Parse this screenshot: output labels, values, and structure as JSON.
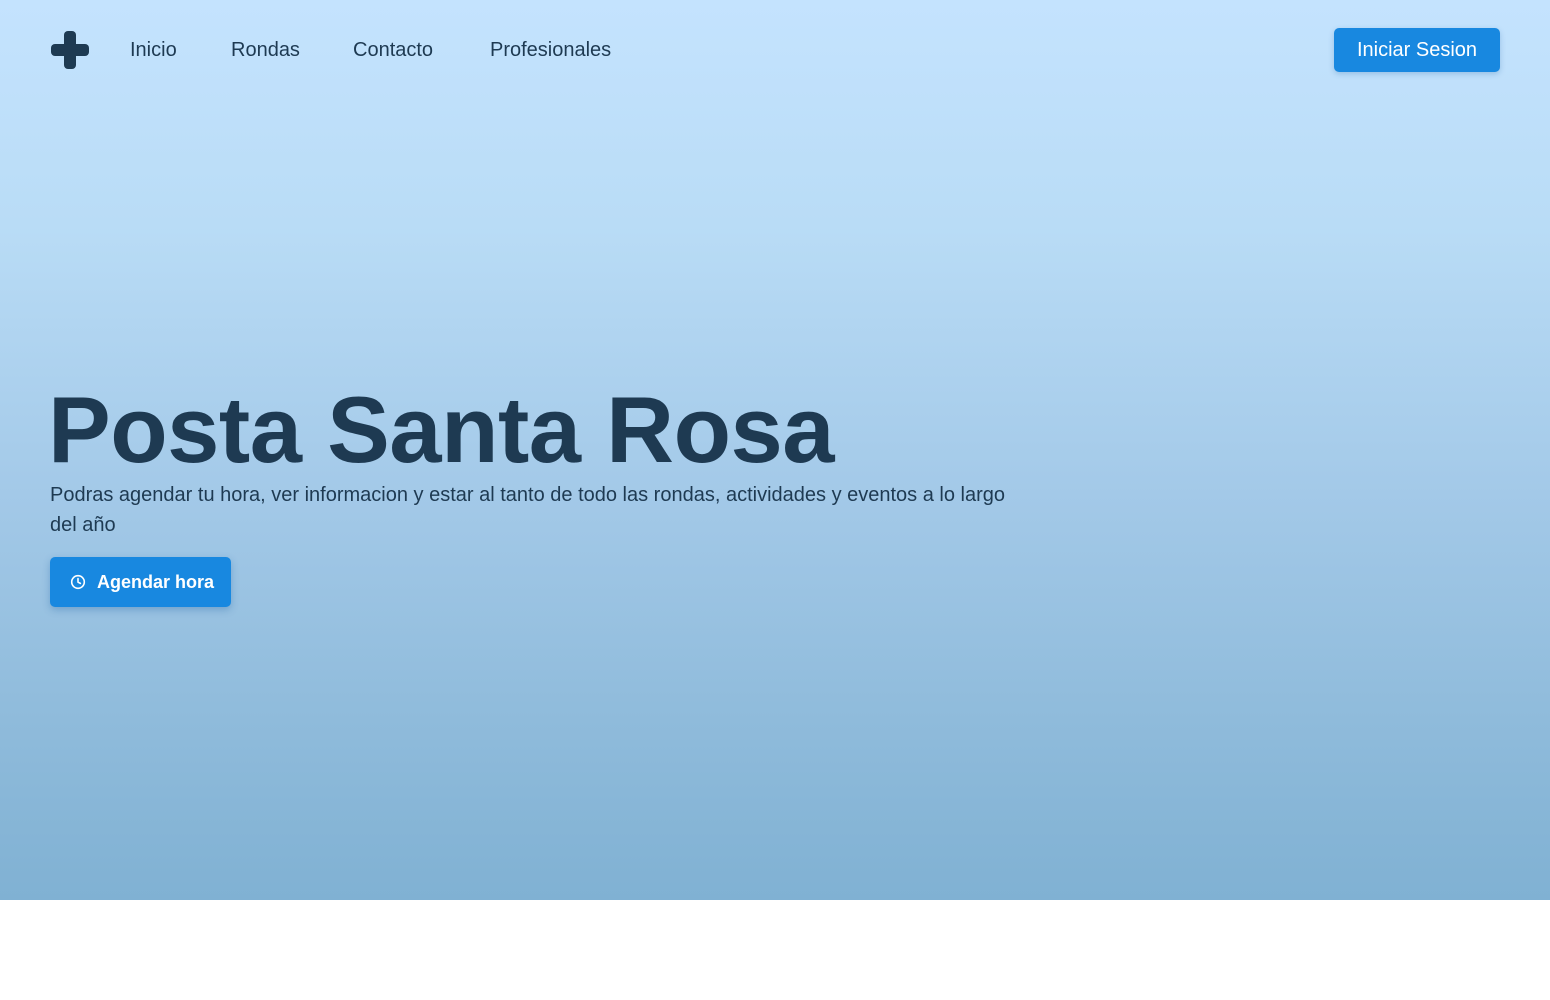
{
  "nav": {
    "logo_icon": "medical-cross-icon",
    "links": [
      "Inicio",
      "Rondas",
      "Contacto",
      "Profesionales"
    ],
    "login_label": "Iniciar Sesion"
  },
  "hero": {
    "title": "Posta Santa Rosa",
    "subtitle": "Podras agendar tu hora, ver informacion y estar al tanto de todo las rondas, actividades y eventos a lo largo del año",
    "cta_label": "Agendar hora",
    "cta_icon": "clock-icon"
  },
  "colors": {
    "primary": "#1888e0",
    "text_dark": "#1e3a52",
    "hero_gradient_top": "#c4e3fe",
    "hero_gradient_bottom": "#80b1d3"
  }
}
